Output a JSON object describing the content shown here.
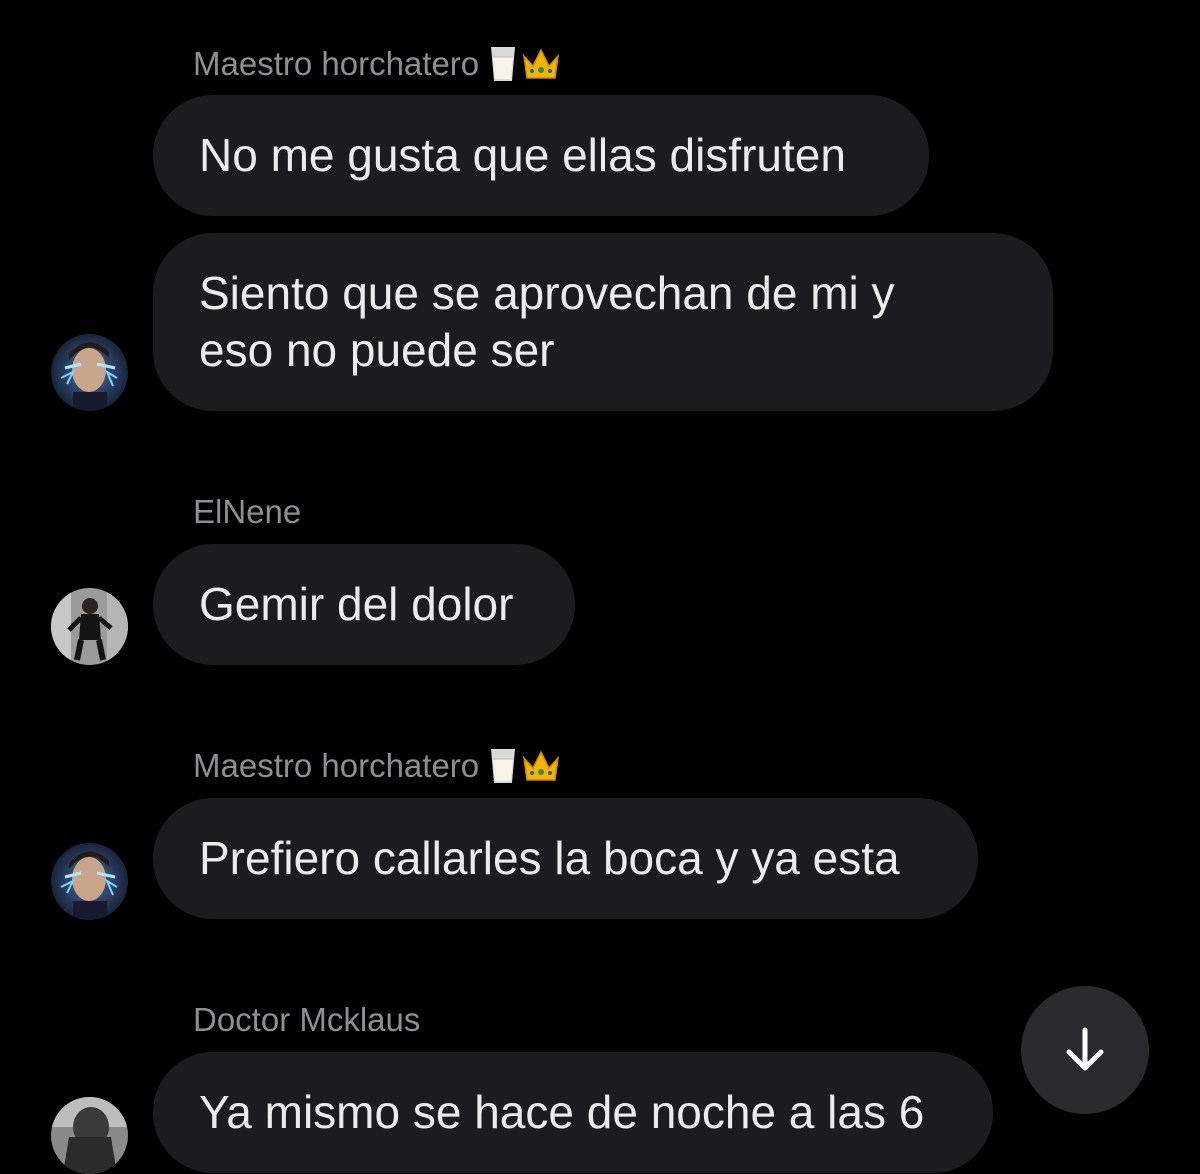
{
  "messages": [
    {
      "sender": "Maestro horchatero",
      "sender_emoji": [
        "milk-glass-icon",
        "crown-icon"
      ],
      "text": "No me gusta que ellas disfruten"
    },
    {
      "sender": "",
      "text": "Siento que se aprovechan de mi y eso no puede ser",
      "lines": [
        "Siento que se aprovechan de mi y",
        "eso no puede ser"
      ]
    },
    {
      "sender": "ElNene",
      "text": "Gemir del dolor"
    },
    {
      "sender": "Maestro horchatero",
      "sender_emoji": [
        "milk-glass-icon",
        "crown-icon"
      ],
      "text": "Prefiero callarles la boca y ya esta"
    },
    {
      "sender": "Doctor Mcklaus",
      "text": "Ya mismo se hace de noche a las 6"
    }
  ],
  "colors": {
    "background": "#000000",
    "bubble": "#1c1c1e",
    "message_text": "#ececec",
    "sender_text": "#8e8e93",
    "scroll_button": "#2b2b2e"
  },
  "icons": {
    "scroll_down": "arrow-down-icon"
  }
}
